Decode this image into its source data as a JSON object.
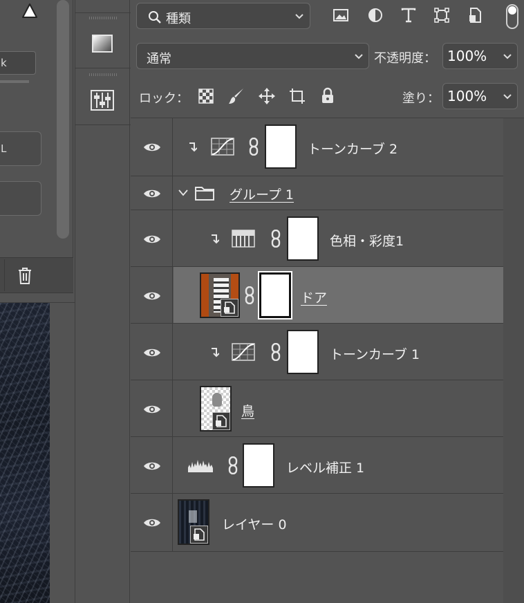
{
  "left_panel": {
    "field_text": "k",
    "button1_text": "L",
    "button2_text": ""
  },
  "layers_panel": {
    "filter": {
      "label": "種類",
      "icons": [
        "image-filter-icon",
        "adjustment-filter-icon",
        "type-filter-icon",
        "shape-filter-icon",
        "smart-object-filter-icon"
      ]
    },
    "blend_mode": "通常",
    "opacity_label": "不透明度：",
    "opacity_value": "100%",
    "lock_label": "ロック：",
    "fill_label": "塗り：",
    "fill_value": "100%",
    "layers": [
      {
        "name": "トーンカーブ 2",
        "type": "curves",
        "clipped": true,
        "has_mask": true,
        "visible": true
      },
      {
        "name": "グループ 1",
        "type": "group",
        "expanded": true,
        "visible": true
      },
      {
        "name": "色相・彩度1",
        "type": "hue-saturation",
        "clipped": true,
        "has_mask": true,
        "visible": true
      },
      {
        "name": "ドア",
        "type": "smart-object",
        "selected": true,
        "has_mask": true,
        "visible": true
      },
      {
        "name": "トーンカーブ 1",
        "type": "curves",
        "clipped": true,
        "has_mask": true,
        "visible": true
      },
      {
        "name": "鳥",
        "type": "smart-object",
        "visible": true
      },
      {
        "name": "レベル補正 1",
        "type": "levels",
        "has_mask": true,
        "visible": true
      },
      {
        "name": "レイヤー 0",
        "type": "smart-object",
        "visible": true
      }
    ]
  },
  "colors": {
    "panel_bg": "#535353",
    "selected_row": "#6f6f6f",
    "field_bg": "#474747"
  }
}
